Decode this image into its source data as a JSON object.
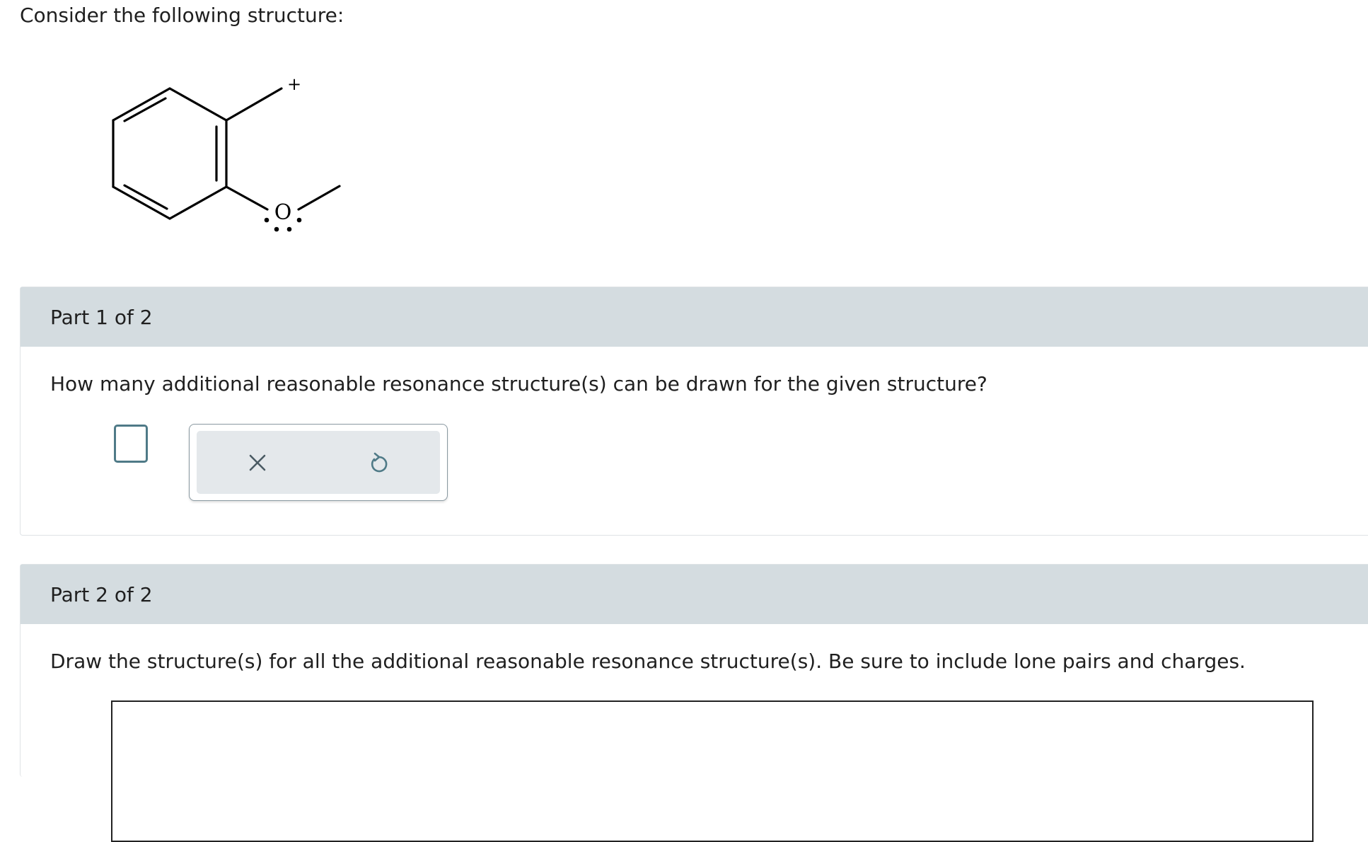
{
  "intro": {
    "text": "Consider the following structure:"
  },
  "structure": {
    "charge_label": "+",
    "atom_label": "O"
  },
  "part1": {
    "header": "Part 1 of 2",
    "question": "How many additional reasonable resonance structure(s) can be drawn for the given structure?",
    "answer_value": "",
    "tools": {
      "clear_icon": "close-icon",
      "undo_icon": "undo-icon"
    }
  },
  "part2": {
    "header": "Part 2 of 2",
    "question": "Draw the structure(s) for all the additional reasonable resonance structure(s). Be sure to include lone pairs and charges."
  }
}
